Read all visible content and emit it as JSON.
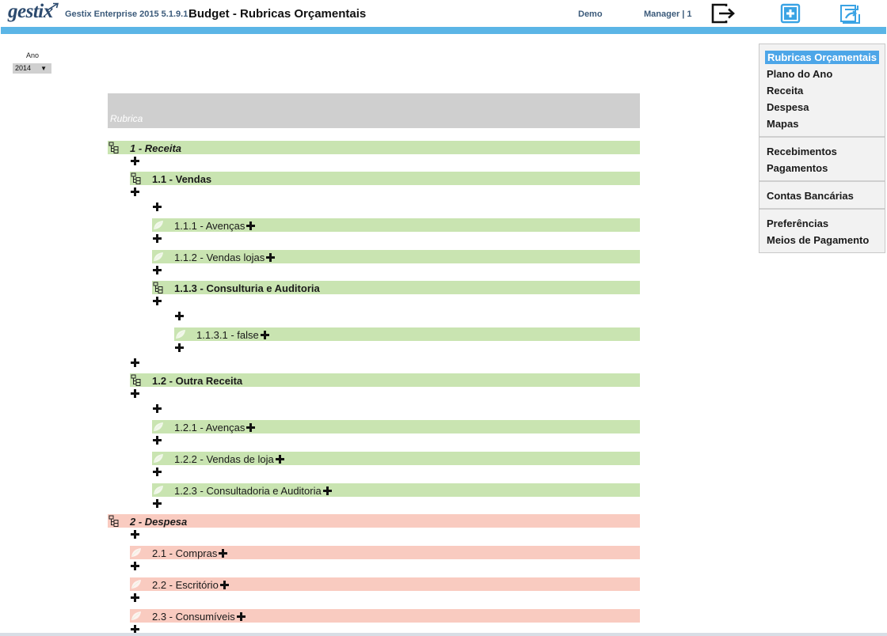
{
  "header": {
    "logo_text": "gestix",
    "app_version": "Gestix Enterprise 2015 5.1.9.1",
    "page_title": "Budget - Rubricas Orçamentais",
    "company": "Demo",
    "user": "Manager | 1",
    "icons": [
      "logout-icon",
      "add-icon",
      "refresh-icon"
    ],
    "accent_color": "#5bb5e6"
  },
  "filter": {
    "year_label": "Ano",
    "year_value": "2014"
  },
  "menu": {
    "group1": [
      "Rubricas Orçamentais",
      "Plano do Ano",
      "Receita",
      "Despesa",
      "Mapas"
    ],
    "group2": [
      "Recebimentos",
      "Pagamentos"
    ],
    "group3": [
      "Contas Bancárias"
    ],
    "group4": [
      "Preferências",
      "Meios de Pagamento"
    ],
    "active": "Rubricas Orçamentais"
  },
  "tree": {
    "column_header": "Rubrica",
    "colors": {
      "receita": "#c9e4b1",
      "despesa": "#f9cbc0"
    },
    "rows": [
      {
        "label": "1 - Receita",
        "level": 0,
        "kind": "branch",
        "type": "receita",
        "style": "bi"
      },
      {
        "label": "1.1 - Vendas",
        "level": 1,
        "kind": "branch",
        "type": "receita",
        "style": "bold"
      },
      {
        "label": "1.1.1 - Avenças",
        "level": 2,
        "kind": "leaf",
        "type": "receita",
        "style": "plain"
      },
      {
        "label": "1.1.2 - Vendas lojas",
        "level": 2,
        "kind": "leaf",
        "type": "receita",
        "style": "plain"
      },
      {
        "label": "1.1.3 - Consulturia e Auditoria",
        "level": 2,
        "kind": "branch",
        "type": "receita",
        "style": "bold"
      },
      {
        "label": "1.1.3.1 - false",
        "level": 3,
        "kind": "leaf",
        "type": "receita",
        "style": "plain"
      },
      {
        "label": "1.2 - Outra Receita",
        "level": 1,
        "kind": "branch",
        "type": "receita",
        "style": "bold"
      },
      {
        "label": "1.2.1 - Avenças",
        "level": 2,
        "kind": "leaf",
        "type": "receita",
        "style": "plain"
      },
      {
        "label": "1.2.2 - Vendas de loja",
        "level": 2,
        "kind": "leaf",
        "type": "receita",
        "style": "plain"
      },
      {
        "label": "1.2.3 - Consultadoria e Auditoria",
        "level": 2,
        "kind": "leaf",
        "type": "receita",
        "style": "plain"
      },
      {
        "label": "2 - Despesa",
        "level": 0,
        "kind": "branch",
        "type": "despesa",
        "style": "bi"
      },
      {
        "label": "2.1 - Compras",
        "level": 1,
        "kind": "leaf",
        "type": "despesa",
        "style": "plain"
      },
      {
        "label": "2.2 - Escritório",
        "level": 1,
        "kind": "leaf",
        "type": "despesa",
        "style": "plain"
      },
      {
        "label": "2.3 - Consumíveis",
        "level": 1,
        "kind": "leaf",
        "type": "despesa",
        "style": "plain"
      }
    ]
  }
}
